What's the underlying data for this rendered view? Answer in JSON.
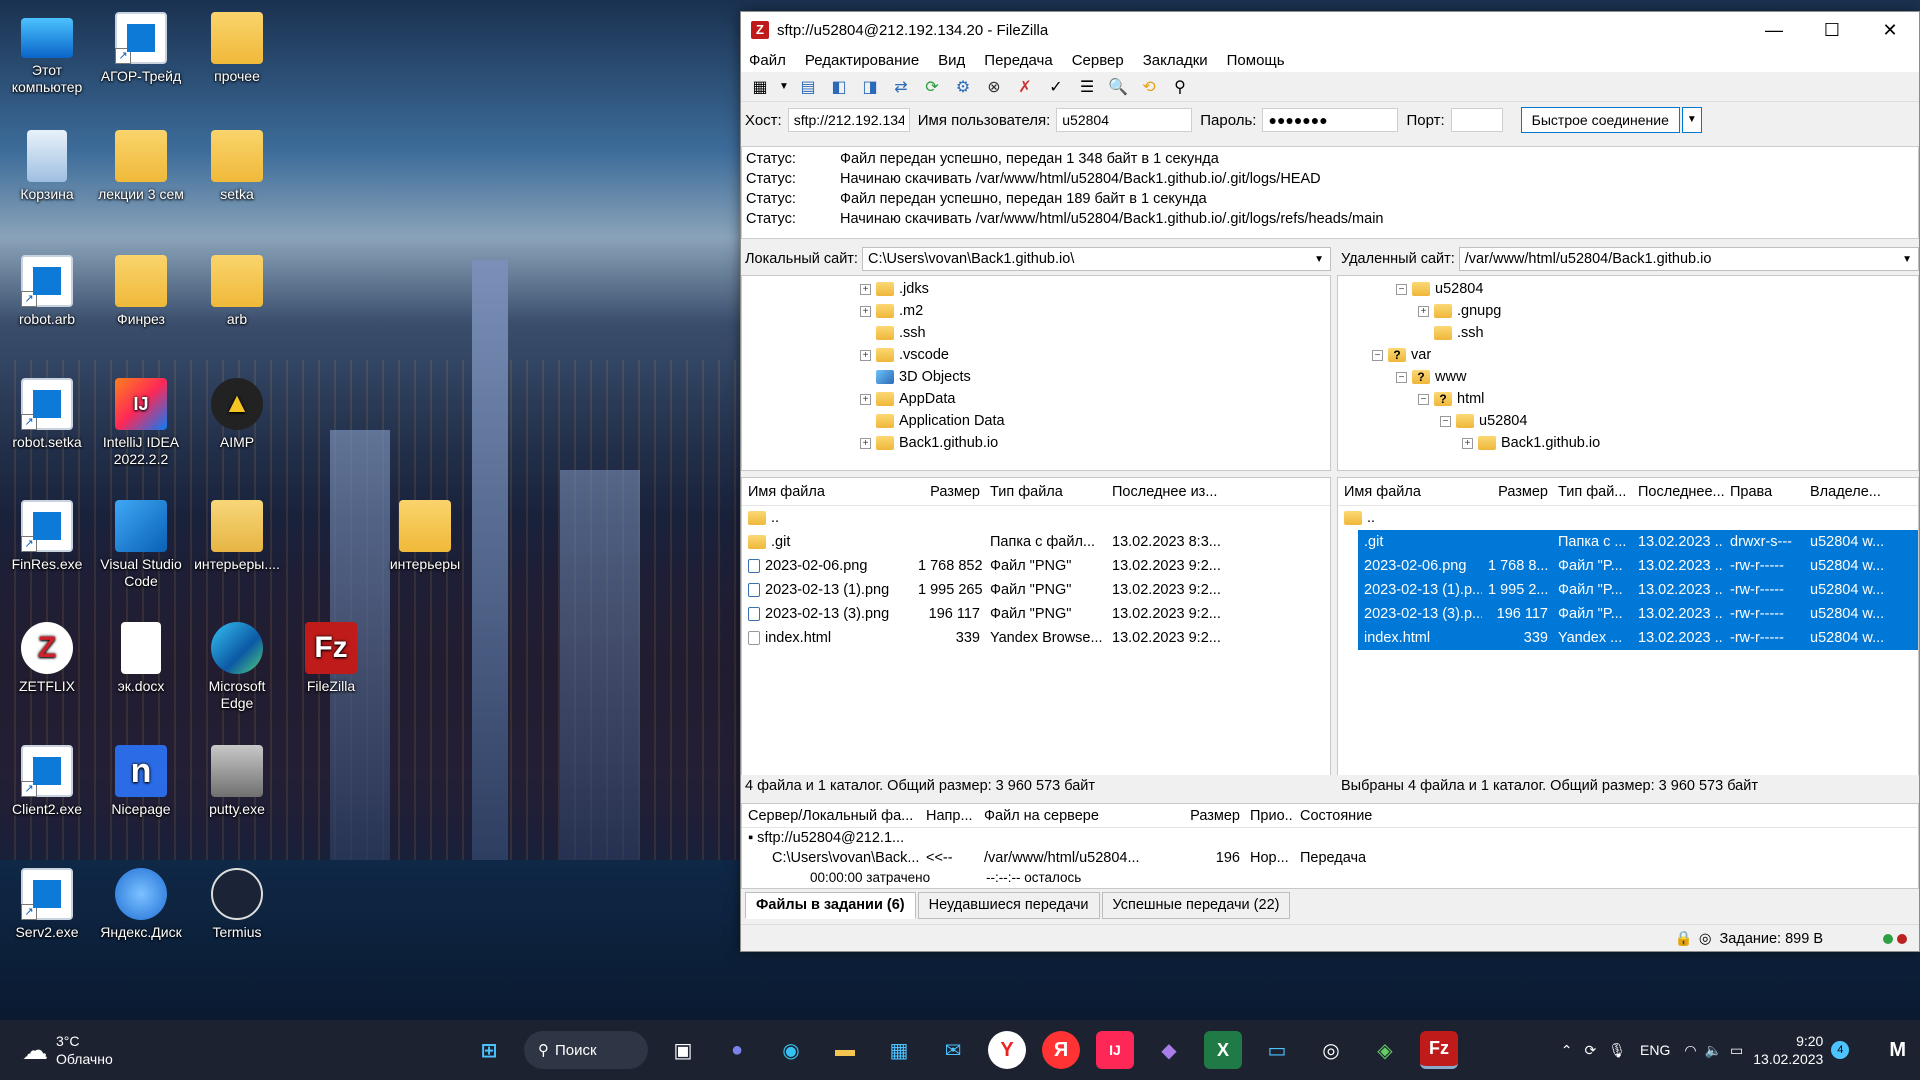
{
  "window": {
    "title": "sftp://u52804@212.192.134.20 - FileZilla"
  },
  "menu": [
    "Файл",
    "Редактирование",
    "Вид",
    "Передача",
    "Сервер",
    "Закладки",
    "Помощь"
  ],
  "quickconnect": {
    "host_label": "Хост:",
    "host_value": "sftp://212.192.134",
    "user_label": "Имя пользователя:",
    "user_value": "u52804",
    "pass_label": "Пароль:",
    "pass_value": "●●●●●●●",
    "port_label": "Порт:",
    "port_value": "",
    "button": "Быстрое соединение"
  },
  "log": [
    {
      "k": "Статус:",
      "v": "Файл передан успешно, передан 1 348 байт в 1 секунда"
    },
    {
      "k": "Статус:",
      "v": "Начинаю скачивать /var/www/html/u52804/Back1.github.io/.git/logs/HEAD"
    },
    {
      "k": "Статус:",
      "v": "Файл передан успешно, передан 189 байт в 1 секунда"
    },
    {
      "k": "Статус:",
      "v": "Начинаю скачивать /var/www/html/u52804/Back1.github.io/.git/logs/refs/heads/main"
    }
  ],
  "local": {
    "site_label": "Локальный сайт:",
    "path": "C:\\Users\\vovan\\Back1.github.io\\",
    "tree": [
      ".jdks",
      ".m2",
      ".ssh",
      ".vscode",
      "3D Objects",
      "AppData",
      "Application Data",
      "Back1.github.io"
    ],
    "headers": [
      "Имя файла",
      "Размер",
      "Тип файла",
      "Последнее из..."
    ],
    "files": [
      {
        "name": "..",
        "size": "",
        "type": "",
        "date": ""
      },
      {
        "name": ".git",
        "size": "",
        "type": "Папка с файл...",
        "date": "13.02.2023 8:3..."
      },
      {
        "name": "2023-02-06.png",
        "size": "1 768 852",
        "type": "Файл \"PNG\"",
        "date": "13.02.2023 9:2..."
      },
      {
        "name": "2023-02-13 (1).png",
        "size": "1 995 265",
        "type": "Файл \"PNG\"",
        "date": "13.02.2023 9:2..."
      },
      {
        "name": "2023-02-13 (3).png",
        "size": "196 117",
        "type": "Файл \"PNG\"",
        "date": "13.02.2023 9:2..."
      },
      {
        "name": "index.html",
        "size": "339",
        "type": "Yandex Browse...",
        "date": "13.02.2023 9:2..."
      }
    ],
    "status": "4 файла и 1 каталог. Общий размер: 3 960 573 байт"
  },
  "remote": {
    "site_label": "Удаленный сайт:",
    "path": "/var/www/html/u52804/Back1.github.io",
    "tree": [
      "u52804",
      ".gnupg",
      ".ssh",
      "var",
      "www",
      "html",
      "u52804",
      "Back1.github.io"
    ],
    "headers": [
      "Имя файла",
      "Размер",
      "Тип фай...",
      "Последнее...",
      "Права",
      "Владеле..."
    ],
    "files": [
      {
        "name": "..",
        "size": "",
        "type": "",
        "date": "",
        "perm": "",
        "owner": ""
      },
      {
        "name": ".git",
        "size": "",
        "type": "Папка с ...",
        "date": "13.02.2023 ...",
        "perm": "drwxr-s---",
        "owner": "u52804 w..."
      },
      {
        "name": "2023-02-06.png",
        "size": "1 768 8...",
        "type": "Файл \"P...",
        "date": "13.02.2023 ...",
        "perm": "-rw-r-----",
        "owner": "u52804 w..."
      },
      {
        "name": "2023-02-13 (1).p...",
        "size": "1 995 2...",
        "type": "Файл \"P...",
        "date": "13.02.2023 ...",
        "perm": "-rw-r-----",
        "owner": "u52804 w..."
      },
      {
        "name": "2023-02-13 (3).p...",
        "size": "196 117",
        "type": "Файл \"P...",
        "date": "13.02.2023 ...",
        "perm": "-rw-r-----",
        "owner": "u52804 w..."
      },
      {
        "name": "index.html",
        "size": "339",
        "type": "Yandex ...",
        "date": "13.02.2023 ...",
        "perm": "-rw-r-----",
        "owner": "u52804 w..."
      }
    ],
    "status": "Выбраны 4 файла и 1 каталог. Общий размер: 3 960 573 байт"
  },
  "queue": {
    "headers": [
      "Сервер/Локальный фа...",
      "Напр...",
      "Файл на сервере",
      "Размер",
      "Прио...",
      "Состояние"
    ],
    "server": "sftp://u52804@212.1...",
    "local": "C:\\Users\\vovan\\Back...",
    "dir": "<<--",
    "remote": "/var/www/html/u52804...",
    "size": "196",
    "prio": "Нор...",
    "state": "Передача",
    "elapsed": "00:00:00 затрачено",
    "left": "--:--:-- осталось"
  },
  "tabs": [
    "Файлы в задании (6)",
    "Неудавшиеся передачи",
    "Успешные передачи (22)"
  ],
  "bottom_status": "Задание: 899 B",
  "desktop": [
    {
      "label": "Этот компьютер"
    },
    {
      "label": "АГОР-Трейд"
    },
    {
      "label": "прочее"
    },
    {
      "label": "Корзина"
    },
    {
      "label": "лекции 3 сем"
    },
    {
      "label": "setka"
    },
    {
      "label": "robot.arb"
    },
    {
      "label": "Финрез"
    },
    {
      "label": "arb"
    },
    {
      "label": "robot.setka"
    },
    {
      "label": "IntelliJ IDEA 2022.2.2"
    },
    {
      "label": "AIMP"
    },
    {
      "label": "FinRes.exe"
    },
    {
      "label": "Visual Studio Code"
    },
    {
      "label": "интерьеры...."
    },
    {
      "label": "интерьеры"
    },
    {
      "label": "ZETFLIX"
    },
    {
      "label": "эк.docx"
    },
    {
      "label": "Microsoft Edge"
    },
    {
      "label": "FileZilla"
    },
    {
      "label": "Client2.exe"
    },
    {
      "label": "Nicepage"
    },
    {
      "label": "putty.exe"
    },
    {
      "label": "Serv2.exe"
    },
    {
      "label": "Яндекс.Диск"
    },
    {
      "label": "Termius"
    }
  ],
  "taskbar": {
    "weather_temp": "3°C",
    "weather_desc": "Облачно",
    "search": "Поиск",
    "lang": "ENG",
    "time": "9:20",
    "date": "13.02.2023",
    "notif": "4"
  }
}
